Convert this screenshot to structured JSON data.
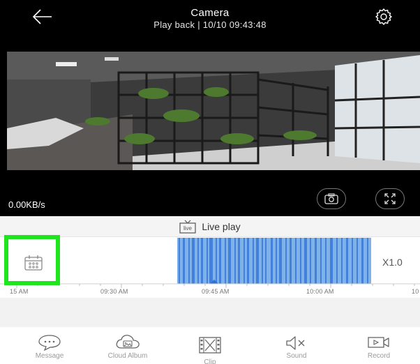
{
  "header": {
    "title": "Camera",
    "subtitle": "Play back | 10/10 09:43:48"
  },
  "video": {
    "speed": "0.00KB/s"
  },
  "liveplay": {
    "label": "Live play"
  },
  "timeline": {
    "zoom": "X1.0",
    "tick_labels": [
      "15 AM",
      "09:30 AM",
      "09:45 AM",
      "10:00 AM",
      "10"
    ],
    "recording_color": "#7fb2e8",
    "recording_stripe_color": "#2f6fd6",
    "cursor_color": "#2f6fd6"
  },
  "toolbar": {
    "items": [
      {
        "label": "Message",
        "icon": "message-icon"
      },
      {
        "label": "Cloud Album",
        "icon": "cloud-album-icon"
      },
      {
        "label": "Clip",
        "icon": "clip-icon"
      },
      {
        "label": "Sound",
        "icon": "sound-off-icon"
      },
      {
        "label": "Record",
        "icon": "record-icon"
      }
    ]
  },
  "colors": {
    "highlight": "#1ee51e",
    "header_bg": "#000000"
  }
}
